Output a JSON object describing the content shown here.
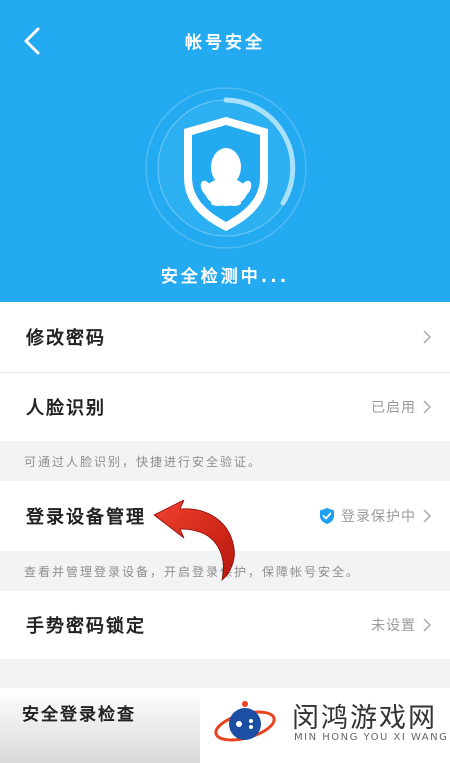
{
  "header": {
    "title": "帐号安全",
    "status": "安全检测中...",
    "bg_color": "#24aaf0"
  },
  "items": {
    "change_password": {
      "label": "修改密码"
    },
    "face_recognition": {
      "label": "人脸识别",
      "value": "已启用"
    },
    "face_note": "可通过人脸识别，快捷进行安全验证。",
    "device_management": {
      "label": "登录设备管理",
      "value": "登录保护中",
      "badge_icon": "shield-check-icon"
    },
    "device_note": "查看并管理登录设备，开启登录保护，保障帐号安全。",
    "gesture_lock": {
      "label": "手势密码锁定",
      "value": "未设置"
    },
    "login_check": {
      "label": "安全登录检查"
    }
  },
  "watermark": {
    "title": "闵鸿游戏网",
    "subtitle": "MIN HONG YOU XI WANG"
  },
  "colors": {
    "accent": "#24aaf0",
    "arrow": "#e0271c"
  }
}
